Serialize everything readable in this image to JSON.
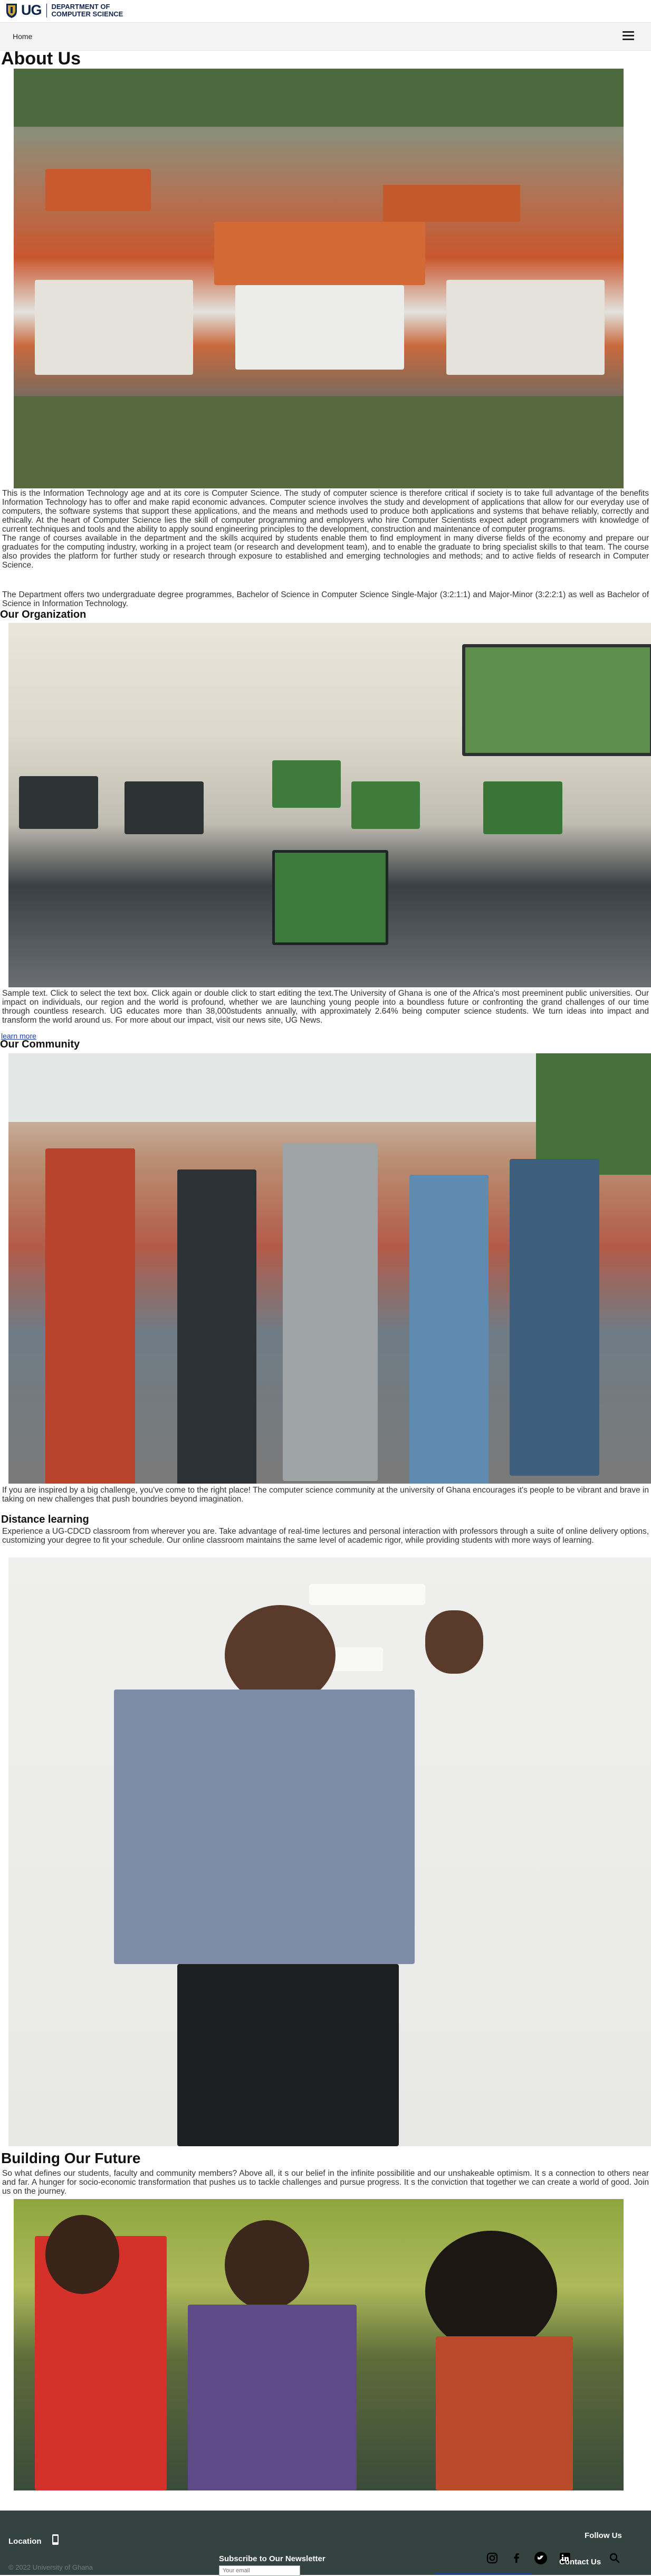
{
  "header": {
    "logo_ug": "UG",
    "logo_line1": "DEPARTMENT OF",
    "logo_line2": "COMPUTER SCIENCE"
  },
  "nav": {
    "home": "Home"
  },
  "about": {
    "title": "About Us",
    "para1": "This is the Information Technology age and at its core is Computer Science. The study of computer science is therefore critical if society is to take full advantage of the benefits Information Technology has to offer and make rapid economic advances. Computer science involves the study and development of applications that allow for our everyday use of computers, the software systems that support these applications, and the means and methods used to produce both applications and systems that behave reliably, correctly and ethically. At the heart of Computer Science lies the skill of computer programming and employers who hire Computer Scientists expect adept programmers with knowledge of current techniques and tools and the ability to apply sound engineering principles to the development, construction and maintenance of computer programs.",
    "para2": "The range of courses available in the department and the skills acquired by students enable them to find employment in many diverse fields of the economy and prepare our graduates for the computing industry, working in a project team (or research and development team), and to enable the graduate to bring specialist skills to that team. The course also provides the platform for further study or research through exposure to established and emerging technologies and methods; and to active fields of research in Computer Science.",
    "para3": "The Department offers two undergraduate degree programmes, Bachelor of Science in Computer Science Single-Major (3:2:1:1) and Major-Minor (3:2:2:1) as well as Bachelor of Science in Information Technology."
  },
  "organization": {
    "title": "Our Organization",
    "para": "Sample text. Click to select the text box. Click again or double click to start editing the text.The University of Ghana is one of the Africa's most preeminent public universities. Our impact on individuals, our region and the world is profound, whether we are launching young people into a boundless future or confronting the grand challenges of our time through countless research. UG educates more than 38,000students annually, with approximately 2.64% being computer science students. We turn ideas into impact and transform the world around us. For more about our impact, visit our news site, UG News.",
    "learn_more": "learn more"
  },
  "community": {
    "title": "Our Community",
    "para": "If you are inspired by a big challenge, you've come to the right place! The computer science community at the university of Ghana encourages it's people to be vibrant and brave in taking on new challenges that push boundries beyond imagination."
  },
  "distance": {
    "title": "Distance learning",
    "para": "Experience a UG-CDCD classroom from wherever you are. Take advantage of real-time lectures and personal interaction with professors through a suite of online delivery options, customizing your degree to fit your schedule. Our online classroom maintains the same level of academic rigor, while providing students with more ways of learning."
  },
  "future": {
    "title": "Building Our Future",
    "para": "So what defines our students, faculty and community members? Above all, it  s our belief in the infinite possibilitie and our unshakeable optimism. It  s a connection to others near and far. A hunger for socio-economic transformation that pushes us to tackle challenges and pursue progress. It  s the conviction that together we can create a world of good. Join us on the journey."
  },
  "footer": {
    "location": "Location",
    "copyright": "© 2022 University of Ghana",
    "subscribe": "Subscribe to Our Newsletter",
    "email_placeholder": "Your email",
    "follow": "Follow Us",
    "contact": "Contact Us"
  },
  "colors": {
    "brand_navy": "#0f2650",
    "footer_bg": "#34433f",
    "link_blue": "#1a3da8"
  },
  "icons": [
    "ug-shield-icon",
    "menu-icon",
    "phone-icon",
    "instagram-icon",
    "facebook-icon",
    "twitter-icon",
    "linkedin-icon",
    "search-icon"
  ]
}
